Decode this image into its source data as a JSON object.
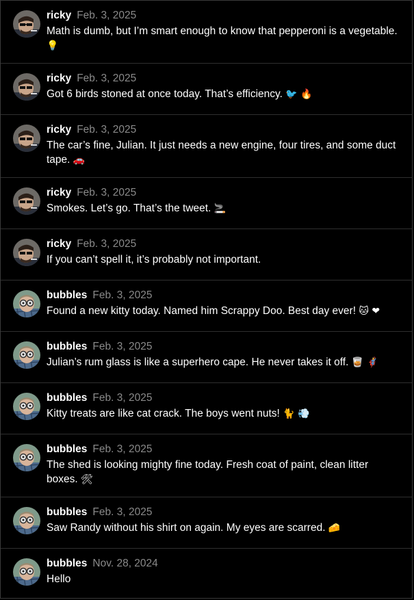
{
  "posts": [
    {
      "user": "ricky",
      "date": "Feb. 3, 2025",
      "text": "Math is dumb, but I’m smart enough to know that pepperoni is a vegetable.",
      "emoji": "💡",
      "avatar": "ricky"
    },
    {
      "user": "ricky",
      "date": "Feb. 3, 2025",
      "text": "Got 6 birds stoned at once today. That’s efficiency.",
      "emoji": "🐦 🔥",
      "avatar": "ricky"
    },
    {
      "user": "ricky",
      "date": "Feb. 3, 2025",
      "text": "The car’s fine, Julian. It just needs a new engine, four tires, and some duct tape.",
      "emoji": "🚗",
      "avatar": "ricky"
    },
    {
      "user": "ricky",
      "date": "Feb. 3, 2025",
      "text": "Smokes. Let’s go. That’s the tweet.",
      "emoji": "🚬",
      "avatar": "ricky"
    },
    {
      "user": "ricky",
      "date": "Feb. 3, 2025",
      "text": "If you can’t spell it, it’s probably not important.",
      "emoji": "",
      "avatar": "ricky"
    },
    {
      "user": "bubbles",
      "date": "Feb. 3, 2025",
      "text": "Found a new kitty today. Named him Scrappy Doo. Best day ever!",
      "emoji": "🐱 ❤",
      "avatar": "bubbles"
    },
    {
      "user": "bubbles",
      "date": "Feb. 3, 2025",
      "text": "Julian’s rum glass is like a superhero cape. He never takes it off.",
      "emoji": "🥃 🦸",
      "avatar": "bubbles"
    },
    {
      "user": "bubbles",
      "date": "Feb. 3, 2025",
      "text": "Kitty treats are like cat crack. The boys went nuts!",
      "emoji": "🐈 💨",
      "avatar": "bubbles"
    },
    {
      "user": "bubbles",
      "date": "Feb. 3, 2025",
      "text": "The shed is looking mighty fine today. Fresh coat of paint, clean litter boxes.",
      "emoji": "🛠",
      "avatar": "bubbles"
    },
    {
      "user": "bubbles",
      "date": "Feb. 3, 2025",
      "text": "Saw Randy without his shirt on again. My eyes are scarred.",
      "emoji": "🧀",
      "avatar": "bubbles"
    },
    {
      "user": "bubbles",
      "date": "Nov. 28, 2024",
      "text": "Hello",
      "emoji": "",
      "avatar": "bubbles"
    }
  ]
}
